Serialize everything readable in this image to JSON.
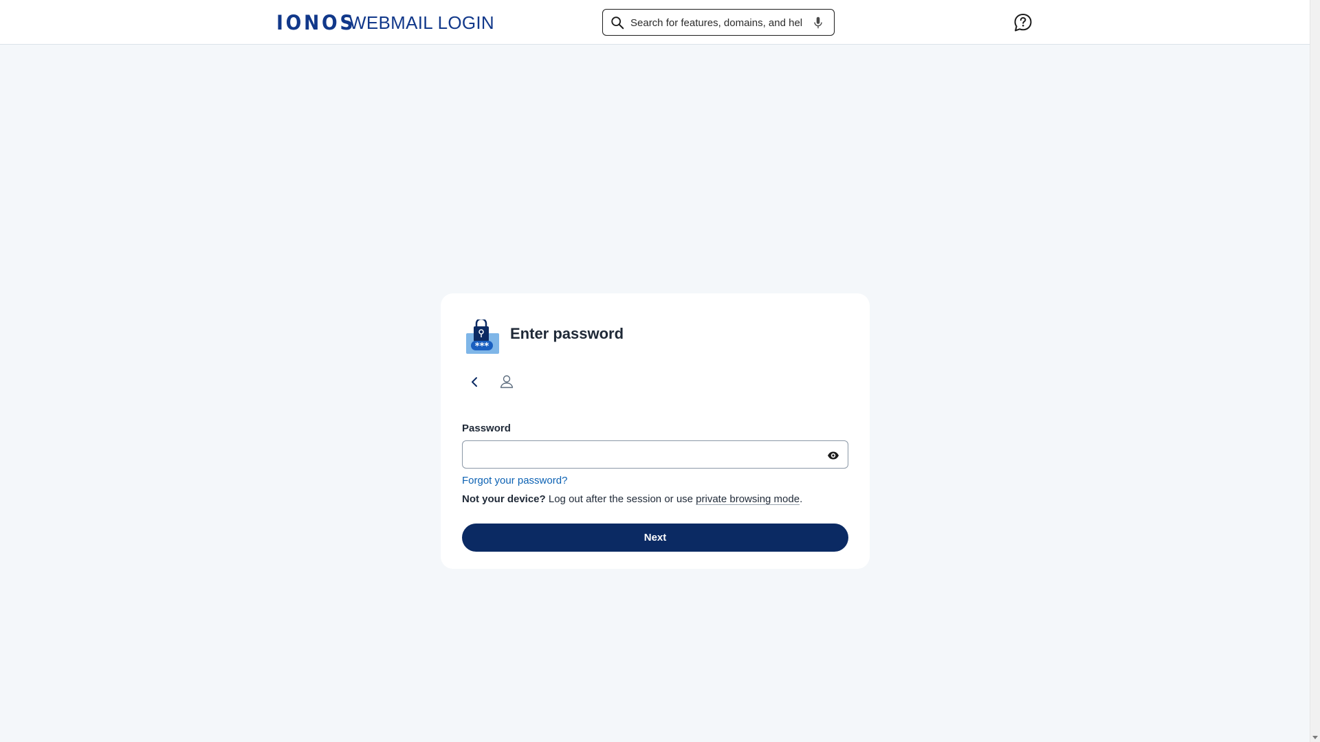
{
  "header": {
    "logo_text": "IONOS",
    "app_title": "WEBMAIL LOGIN",
    "search": {
      "placeholder": "Search for features, domains, and help",
      "value": ""
    },
    "icons": {
      "search": "search-icon",
      "mic": "microphone-icon",
      "help": "help-chat-icon"
    }
  },
  "card": {
    "title": "Enter password",
    "illustration": "lock-password-icon",
    "nav": {
      "back": "chevron-left-icon",
      "user": "user-icon"
    },
    "password": {
      "label": "Password",
      "value": "",
      "toggle_icon": "eye-icon"
    },
    "forgot_link": "Forgot your password?",
    "device_note": {
      "bold": "Not your device?",
      "text": " Log out after the session or use ",
      "link": "private browsing mode",
      "end": "."
    },
    "next_label": "Next"
  },
  "colors": {
    "brand": "#11388a",
    "primary_button": "#0b2a63",
    "link": "#0b61b3",
    "page_background": "#f4f7fa"
  }
}
